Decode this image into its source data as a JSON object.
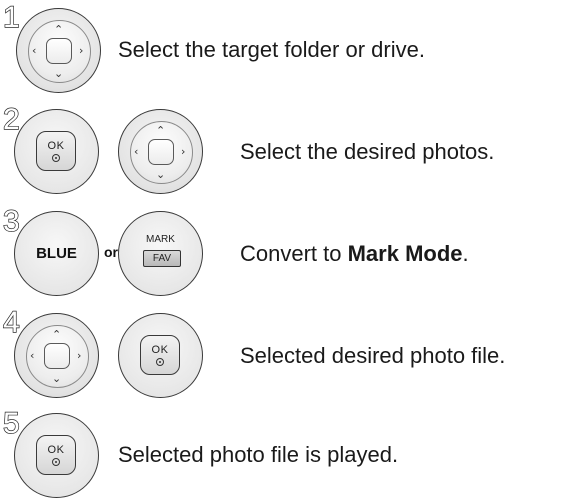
{
  "steps": [
    {
      "number": "1",
      "description": "Select the target folder or drive."
    },
    {
      "number": "2",
      "description": "Select the desired photos."
    },
    {
      "number": "3",
      "description_prefix": "Convert to ",
      "description_bold": "Mark Mode",
      "description_suffix": "."
    },
    {
      "number": "4",
      "description": "Selected desired photo file."
    },
    {
      "number": "5",
      "description": "Selected photo file is played."
    }
  ],
  "keys": {
    "ok_label": "OK",
    "blue_label": "BLUE",
    "or_label": "or",
    "mark_label": "MARK",
    "fav_label": "FAV"
  },
  "icons": {
    "nav_up": "▲",
    "nav_down": "▼",
    "nav_left": "◀",
    "nav_right": "▶"
  }
}
